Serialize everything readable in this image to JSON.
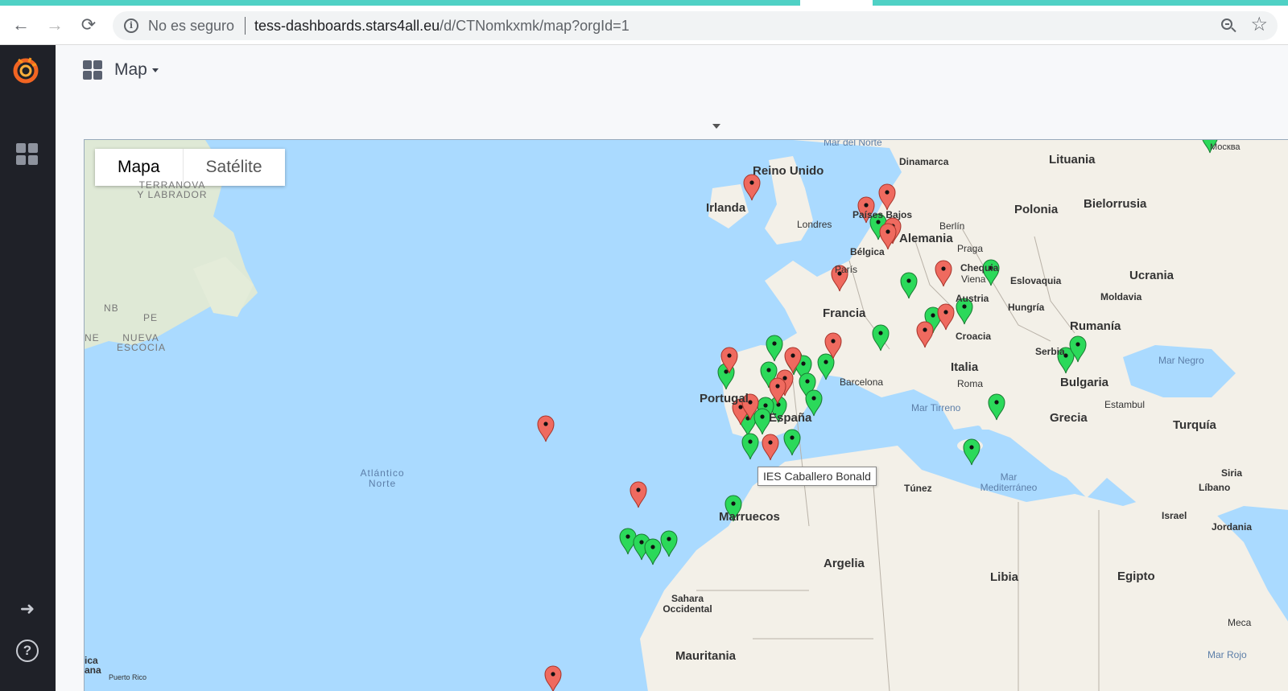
{
  "browser": {
    "security_text": "No es seguro",
    "url_host": "tess-dashboards.stars4all.eu",
    "url_path": "/d/CTNomkxmk/map?orgId=1"
  },
  "dashboard": {
    "title": "Map"
  },
  "map": {
    "type_buttons": {
      "map": "Mapa",
      "satellite": "Satélite"
    },
    "tooltip": "IES Caballero Bonald",
    "colors": {
      "ok_marker": "#2bd95a",
      "off_marker": "#ef6a5f",
      "sea": "#aadaff",
      "land": "#f3f0e8"
    },
    "labels": {
      "reino_unido": "Reino Unido",
      "irlanda": "Irlanda",
      "londres": "Londres",
      "paises_bajos": "Países Bajos",
      "belgica": "Bélgica",
      "alemania": "Alemania",
      "berlin": "Berlín",
      "polonia": "Polonia",
      "bielorrusia": "Bielorrusia",
      "lituania": "Lituania",
      "dinamarca": "Dinamarca",
      "praga": "Praga",
      "chequia": "Chequia",
      "viena": "Viena",
      "eslovaquia": "Eslovaquia",
      "ucrania": "Ucrania",
      "moldavia": "Moldavia",
      "austria": "Austria",
      "hungria": "Hungría",
      "rumania": "Rumanía",
      "francia": "Francia",
      "paris": "París",
      "croacia": "Croacia",
      "serbia": "Serbia",
      "bulgaria": "Bulgaria",
      "italia": "Italia",
      "roma": "Roma",
      "barcelona": "Barcelona",
      "portugal": "Portugal",
      "espana": "España",
      "grecia": "Grecia",
      "turquia": "Turquía",
      "estambul": "Estambul",
      "tunez": "Túnez",
      "marruecos": "Marruecos",
      "argelia": "Argelia",
      "libia": "Libia",
      "egipto": "Egipto",
      "siria": "Siria",
      "libano": "Líbano",
      "israel": "Israel",
      "jordania": "Jordania",
      "sahara": "Sahara Occidental",
      "mauritania": "Mauritania",
      "meca": "Meca",
      "moscu": "Москва",
      "mar_del_norte": "Mar del Norte",
      "mar_negro": "Mar Negro",
      "mar_tirreno": "Mar Tirreno",
      "mar_mediterraneo": "Mar Mediterráneo",
      "atlantico": "Atlántico Norte",
      "mar_rojo": "Mar Rojo",
      "terranova": "TERRANOVA Y LABRADOR",
      "nueva_escocia": "NUEVA ESCOCIA",
      "nb": "NB",
      "pe": "PE",
      "ne": "NE",
      "puerto_rico": "Puerto Rico",
      "rica": "ica",
      "ana": "ana"
    }
  }
}
